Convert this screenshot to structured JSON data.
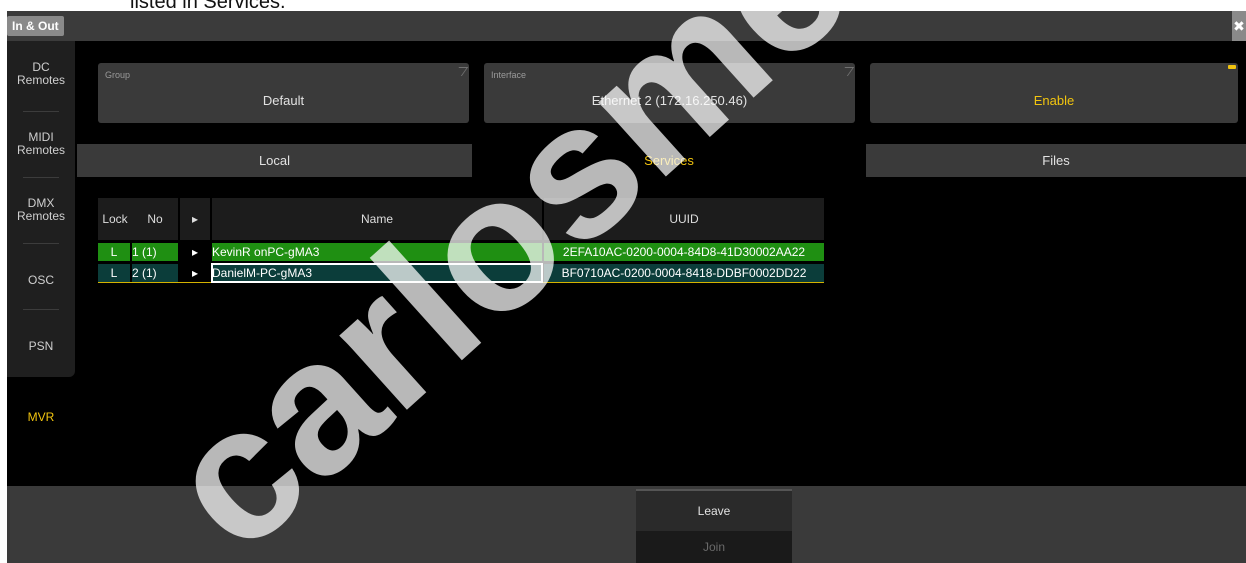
{
  "page_caption": "listed in Services.",
  "window": {
    "title": "In & Out",
    "close_icon": "close-icon"
  },
  "sidebar": {
    "items": [
      {
        "label": "DC\nRemotes"
      },
      {
        "label": "MIDI\nRemotes"
      },
      {
        "label": "DMX\nRemotes"
      },
      {
        "label": "OSC"
      },
      {
        "label": "PSN"
      },
      {
        "label": "MVR",
        "active": true
      }
    ]
  },
  "fields": {
    "group": {
      "label": "Group",
      "value": "Default"
    },
    "interface": {
      "label": "Interface",
      "value": "Ethernet 2 (172.16.250.46)"
    },
    "enable": {
      "value": "Enable"
    }
  },
  "tabs": [
    {
      "label": "Local"
    },
    {
      "label": "Services",
      "active": true
    },
    {
      "label": "Files"
    }
  ],
  "table": {
    "headers": {
      "lock": "Lock",
      "no": "No",
      "expand": "▸",
      "name": "Name",
      "uuid": "UUID"
    },
    "rows": [
      {
        "lock": "L",
        "no": "1 (1)",
        "expand": "▸",
        "name": "KevinR onPC-gMA3",
        "uuid": "2EFA10AC-0200-0004-84D8-41D30002AA22"
      },
      {
        "lock": "L",
        "no": "2 (1)",
        "expand": "▸",
        "name": "DanielM-PC-gMA3",
        "uuid": "BF0710AC-0200-0004-8418-DDBF0002DD22"
      }
    ]
  },
  "buttons": {
    "leave": "Leave",
    "join": "Join"
  },
  "watermark": {
    "text": "carlosmen"
  },
  "colors": {
    "accent": "#f1c40f",
    "row_green": "#1f8f12",
    "row_selected": "#0b3d3a"
  }
}
